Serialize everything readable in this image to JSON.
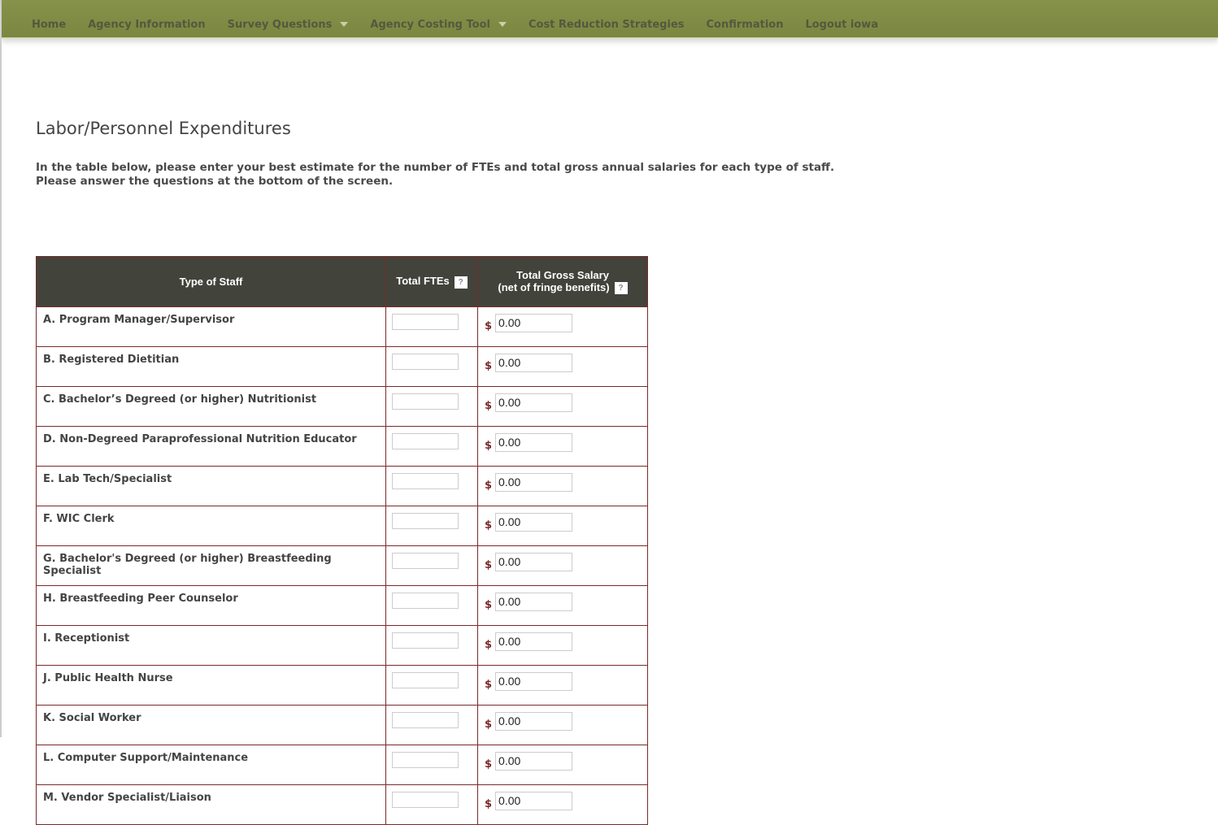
{
  "nav": [
    {
      "label": "Home"
    },
    {
      "label": "Agency Information"
    },
    {
      "label": "Survey Questions",
      "dropdown": true
    },
    {
      "label": "Agency Costing Tool",
      "dropdown": true
    },
    {
      "label": "Cost Reduction Strategies"
    },
    {
      "label": "Confirmation"
    },
    {
      "label": "Logout iowa"
    }
  ],
  "title": "Labor/Personnel Expenditures",
  "intro1": "In the table below, please enter your best estimate for the number of FTEs and total gross annual salaries for each type of staff.",
  "intro2": "Please answer the questions at the bottom of the screen.",
  "table": {
    "h_staff": "Type of Staff",
    "h_fte": "Total FTEs",
    "h_sal1": "Total Gross Salary",
    "h_sal2": "(net of fringe benefits)",
    "help": "?",
    "currency": "$",
    "rows": [
      {
        "label": "A. Program Manager/Supervisor",
        "fte": "",
        "salary": "0.00"
      },
      {
        "label": "B. Registered Dietitian",
        "fte": "",
        "salary": "0.00"
      },
      {
        "label": "C. Bachelor’s Degreed (or higher) Nutritionist",
        "fte": "",
        "salary": "0.00"
      },
      {
        "label": "D. Non-Degreed Paraprofessional Nutrition Educator",
        "fte": "",
        "salary": "0.00"
      },
      {
        "label": "E. Lab Tech/Specialist",
        "fte": "",
        "salary": "0.00"
      },
      {
        "label": "F. WIC Clerk",
        "fte": "",
        "salary": "0.00"
      },
      {
        "label": "G. Bachelor's Degreed (or higher) Breastfeeding Specialist",
        "fte": "",
        "salary": "0.00"
      },
      {
        "label": "H. Breastfeeding Peer Counselor",
        "fte": "",
        "salary": "0.00"
      },
      {
        "label": "I. Receptionist",
        "fte": "",
        "salary": "0.00"
      },
      {
        "label": "J. Public Health Nurse",
        "fte": "",
        "salary": "0.00"
      },
      {
        "label": "K. Social Worker",
        "fte": "",
        "salary": "0.00"
      },
      {
        "label": "L. Computer Support/Maintenance",
        "fte": "",
        "salary": "0.00"
      },
      {
        "label": "M. Vendor Specialist/Liaison",
        "fte": "",
        "salary": "0.00"
      }
    ]
  }
}
